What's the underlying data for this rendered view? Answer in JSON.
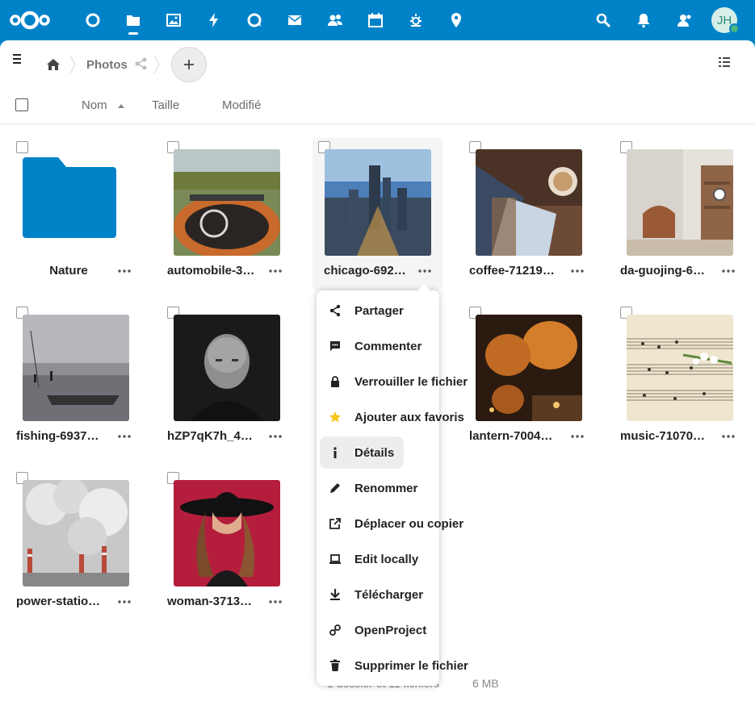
{
  "header": {
    "apps": [
      {
        "icon": "dashboard-icon"
      },
      {
        "icon": "files-icon"
      },
      {
        "icon": "photos-icon"
      },
      {
        "icon": "activity-icon"
      },
      {
        "icon": "talk-icon"
      },
      {
        "icon": "mail-icon"
      },
      {
        "icon": "contacts-icon"
      },
      {
        "icon": "calendar-icon"
      },
      {
        "icon": "weather-icon"
      },
      {
        "icon": "maps-icon"
      }
    ],
    "avatar_initials": "JH",
    "accent_color": "#0082c9"
  },
  "breadcrumb": {
    "current": "Photos"
  },
  "columns": {
    "name": "Nom",
    "size": "Taille",
    "modified": "Modifié"
  },
  "files": [
    {
      "name": "Nature",
      "type": "folder"
    },
    {
      "name": "automobile-3…",
      "type": "image"
    },
    {
      "name": "chicago-692…",
      "type": "image",
      "highlighted": true
    },
    {
      "name": "coffee-71219…",
      "type": "image"
    },
    {
      "name": "da-guojing-6…",
      "type": "image"
    },
    {
      "name": "fishing-6937…",
      "type": "image"
    },
    {
      "name": "hZP7qK7h_4…",
      "type": "image"
    },
    {
      "name": "lantern-7004…",
      "type": "image"
    },
    {
      "name": "music-71070…",
      "type": "image"
    },
    {
      "name": "power-statio…",
      "type": "image"
    },
    {
      "name": "woman-3713…",
      "type": "image"
    }
  ],
  "context_menu": {
    "items": [
      {
        "label": "Partager",
        "icon": "share-icon"
      },
      {
        "label": "Commenter",
        "icon": "comment-icon"
      },
      {
        "label": "Verrouiller le fichier",
        "icon": "lock-icon"
      },
      {
        "label": "Ajouter aux favoris",
        "icon": "star-icon"
      },
      {
        "label": "Détails",
        "icon": "info-icon",
        "active": true
      },
      {
        "label": "Renommer",
        "icon": "pencil-icon"
      },
      {
        "label": "Déplacer ou copier",
        "icon": "external-link-icon"
      },
      {
        "label": "Edit locally",
        "icon": "laptop-icon"
      },
      {
        "label": "Télécharger",
        "icon": "download-icon"
      },
      {
        "label": "OpenProject",
        "icon": "link-icon"
      },
      {
        "label": "Supprimer le fichier",
        "icon": "trash-icon"
      }
    ]
  },
  "summary": {
    "counts": "1 dossier et 11 fichiers",
    "size": "6 MB"
  }
}
